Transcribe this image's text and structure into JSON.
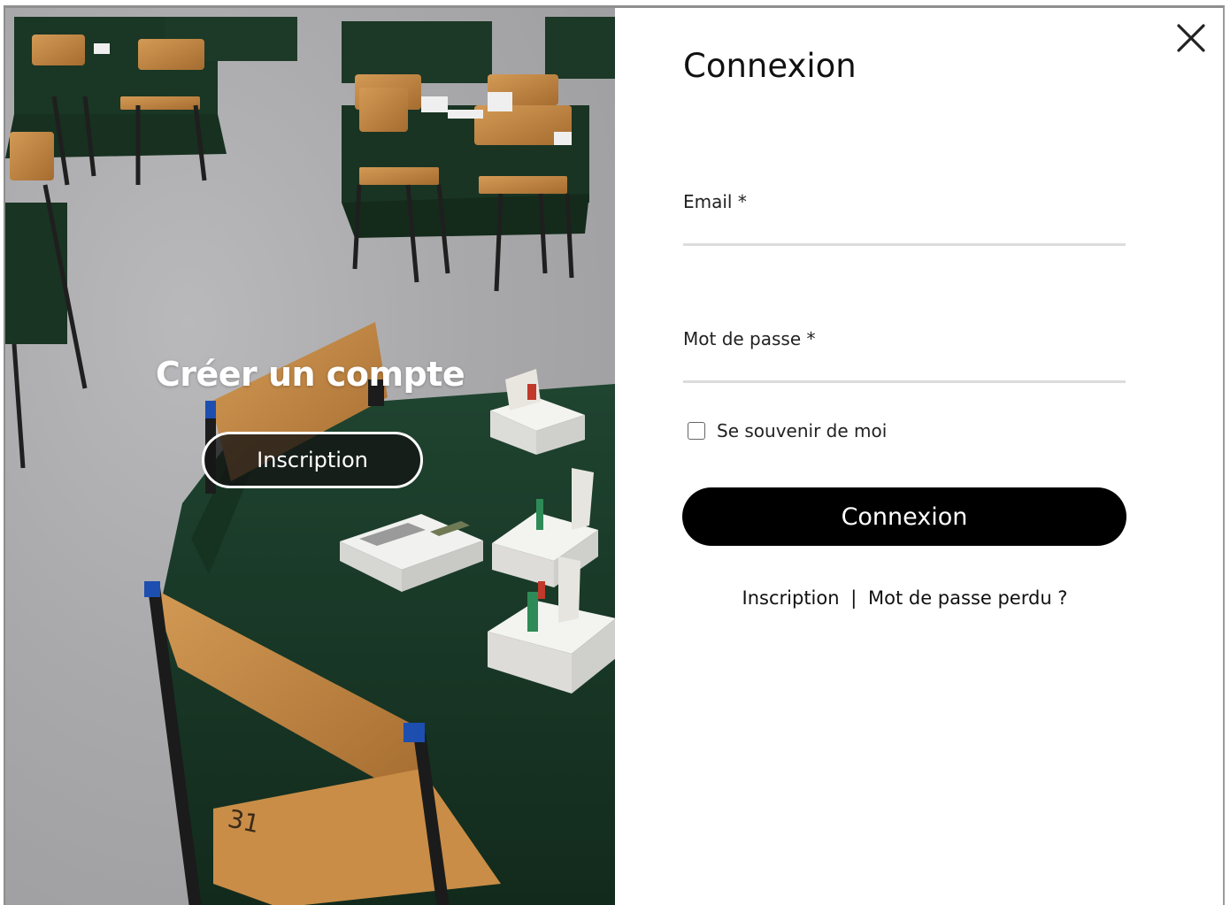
{
  "photo_panel": {
    "title": "Créer un compte",
    "button_label": "Inscription",
    "table_number": "31"
  },
  "login_form": {
    "heading": "Connexion",
    "email_label": "Email *",
    "email_value": "",
    "password_label": "Mot de passe *",
    "password_value": "",
    "remember_label": "Se souvenir de moi",
    "remember_checked": false,
    "submit_label": "Connexion",
    "register_link": "Inscription",
    "separator": "|",
    "lost_password_link": "Mot de passe perdu ?"
  },
  "icons": {
    "close": "close-icon",
    "checkbox": "checkbox-icon"
  },
  "colors": {
    "primary_button": "#000000",
    "table_cloth": "#1a3a26",
    "chair_wood": "#c48a48",
    "input_underline": "#dcdcdc"
  }
}
